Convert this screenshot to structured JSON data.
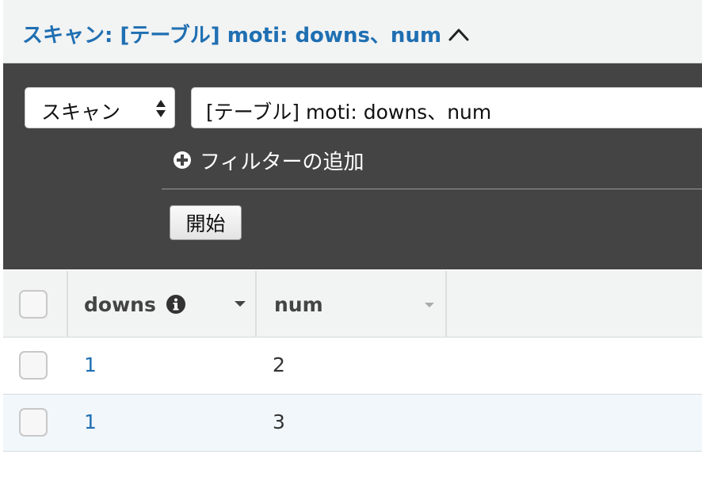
{
  "header": {
    "title": "スキャン: [テーブル] moti: downs、num",
    "toggle_icon": "chevron-up-icon"
  },
  "scan_panel": {
    "mode_select": {
      "value": "スキャン"
    },
    "target_select": {
      "value": "[テーブル] moti: downs、num"
    },
    "add_filter_label": "フィルターの追加",
    "start_button_label": "開始"
  },
  "table": {
    "columns": [
      {
        "label": "downs",
        "has_info_icon": true
      },
      {
        "label": "num",
        "has_info_icon": false
      }
    ],
    "rows": [
      {
        "downs": "1",
        "num": "2"
      },
      {
        "downs": "1",
        "num": "3"
      }
    ]
  },
  "colors": {
    "accent": "#1f6fb2",
    "panel_bg": "#444444",
    "header_bg": "#f2f3f3",
    "row_highlight": "#f1f7fb"
  }
}
